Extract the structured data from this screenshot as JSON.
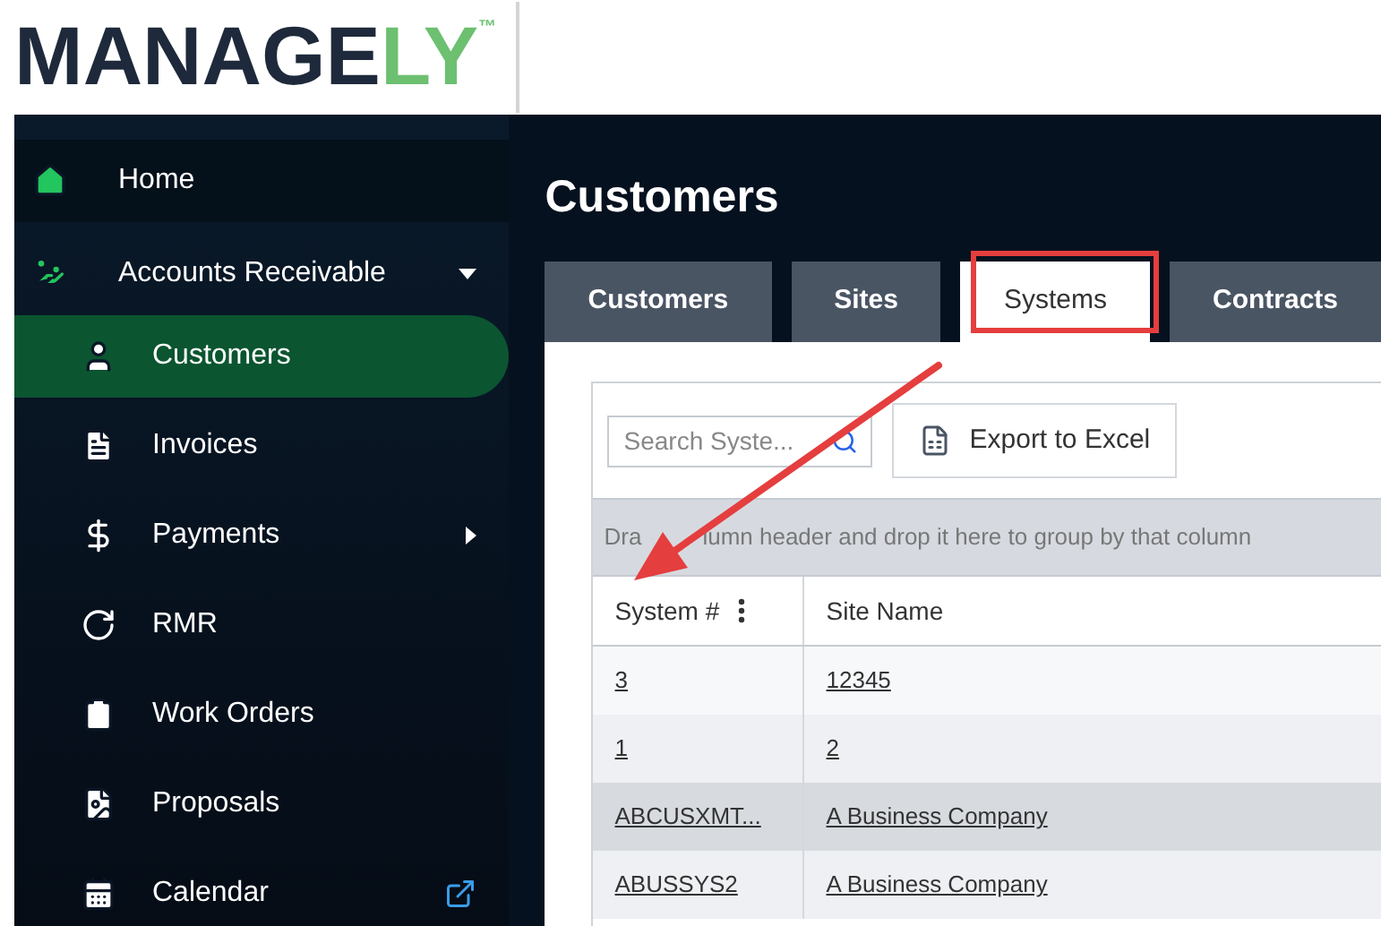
{
  "logo": {
    "text": "MANAGE",
    "accent": "LY",
    "mark": "™"
  },
  "sidebar": {
    "items": [
      {
        "label": "Home",
        "kind": "plain",
        "selected": false
      },
      {
        "label": "Accounts Receivable",
        "kind": "submenu",
        "expanded": true,
        "selected": false,
        "children": [
          {
            "label": "Customers",
            "kind": "plain",
            "selected": true
          },
          {
            "label": "Invoices",
            "kind": "plain",
            "selected": false
          },
          {
            "label": "Payments",
            "kind": "submenu",
            "expanded": false,
            "selected": false
          },
          {
            "label": "RMR",
            "kind": "plain",
            "selected": false
          },
          {
            "label": "Work Orders",
            "kind": "plain",
            "selected": false
          },
          {
            "label": "Proposals",
            "kind": "plain",
            "selected": false
          },
          {
            "label": "Calendar",
            "kind": "external",
            "selected": false
          }
        ]
      }
    ]
  },
  "page": {
    "title": "Customers"
  },
  "tabs": [
    {
      "label": "Customers",
      "selected": false
    },
    {
      "label": "Sites",
      "selected": false
    },
    {
      "label": "Systems",
      "selected": true
    },
    {
      "label": "Contracts",
      "selected": false
    }
  ],
  "toolbar": {
    "search": {
      "placeholder": "Search Syste..."
    },
    "export_button": "Export to Excel"
  },
  "group_panel": {
    "parts": [
      "Dra",
      "lumn header and drop it here to group by that column"
    ]
  },
  "table": {
    "columns": [
      "System #",
      "Site Name"
    ],
    "rows": [
      {
        "cells": [
          "3",
          "12345"
        ],
        "selected": false
      },
      {
        "cells": [
          "1",
          "2"
        ],
        "selected": false
      },
      {
        "cells": [
          "ABCUSXMT...",
          "A Business Company"
        ],
        "selected": true
      },
      {
        "cells": [
          "ABUSSYS2",
          "A Business Company"
        ],
        "selected": false
      }
    ]
  }
}
